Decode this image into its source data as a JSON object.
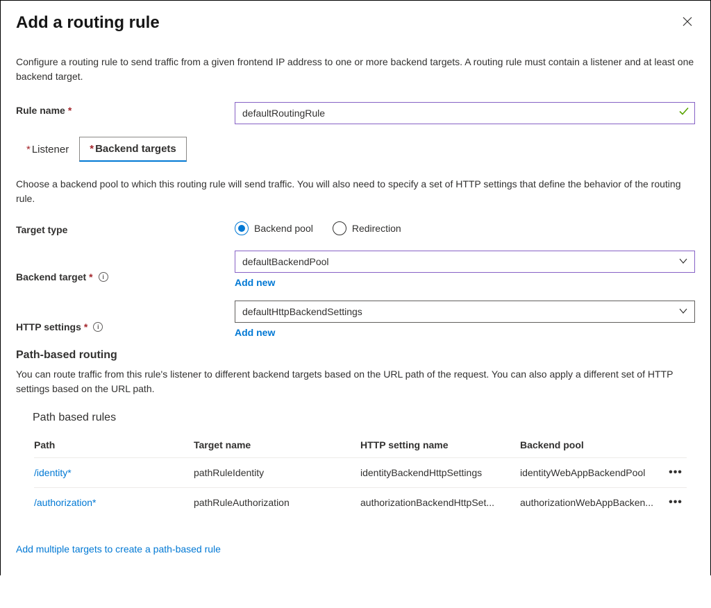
{
  "header": {
    "title": "Add a routing rule"
  },
  "description": "Configure a routing rule to send traffic from a given frontend IP address to one or more backend targets. A routing rule must contain a listener and at least one backend target.",
  "fields": {
    "rule_name_label": "Rule name",
    "rule_name_value": "defaultRoutingRule",
    "target_type_label": "Target type",
    "target_type_opt1": "Backend pool",
    "target_type_opt2": "Redirection",
    "backend_target_label": "Backend target",
    "backend_target_value": "defaultBackendPool",
    "http_settings_label": "HTTP settings",
    "http_settings_value": "defaultHttpBackendSettings",
    "add_new": "Add new"
  },
  "tabs": {
    "listener": "Listener",
    "backend": "Backend targets"
  },
  "tab_desc": "Choose a backend pool to which this routing rule will send traffic. You will also need to specify a set of HTTP settings that define the behavior of the routing rule.",
  "path_section": {
    "heading": "Path-based routing",
    "desc": "You can route traffic from this rule's listener to different backend targets based on the URL path of the request. You can also apply a different set of HTTP settings based on the URL path.",
    "table_title": "Path based rules",
    "cols": {
      "path": "Path",
      "target": "Target name",
      "http": "HTTP setting name",
      "pool": "Backend pool"
    },
    "rows": [
      {
        "path": "/identity*",
        "target": "pathRuleIdentity",
        "http": "identityBackendHttpSettings",
        "pool": "identityWebAppBackendPool"
      },
      {
        "path": "/authorization*",
        "target": "pathRuleAuthorization",
        "http": "authorizationBackendHttpSet...",
        "pool": "authorizationWebAppBacken..."
      }
    ],
    "add_multi": "Add multiple targets to create a path-based rule"
  }
}
